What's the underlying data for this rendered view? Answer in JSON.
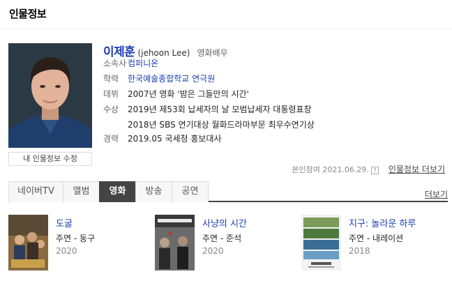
{
  "section": {
    "title": "인물정보"
  },
  "person": {
    "name": "이제훈",
    "name_en": "(jehoon Lee)",
    "role": "영화배우",
    "edit_button": "내 인물정보 수정",
    "info": {
      "agency_label": "소속사",
      "agency": "컴퍼니온",
      "edu_label": "학력",
      "edu": "한국예술종합학교 연극원",
      "debut_label": "데뷔",
      "debut": "2007년 영화 '밤은 그들만의 시간'",
      "award_label": "수상",
      "awards": [
        "2019년 제53회 납세자의 날 모범납세자 대통령표창",
        "2018년 SBS 연기대상 월화드라마부문 최우수연기상"
      ],
      "career_label": "경력",
      "career": "2019.05 국세청 홍보대사"
    },
    "meta": {
      "date_text": "본인참여 2021.06.29.",
      "help": "?",
      "more": "인물정보 더보기"
    }
  },
  "tabs": {
    "items": [
      "네이버TV",
      "앨범",
      "영화",
      "방송",
      "공연"
    ],
    "active": "영화",
    "more": "더보기"
  },
  "movies": [
    {
      "title": "도굴",
      "role": "주연 - 동구",
      "year": "2020"
    },
    {
      "title": "사냥의 시간",
      "role": "주연 - 준석",
      "year": "2020"
    },
    {
      "title": "지구: 놀라운 하루",
      "role": "주연 - 내레이션",
      "year": "2018"
    }
  ],
  "colors": {
    "link": "#1a3eb3",
    "active_tab": "#444444"
  }
}
